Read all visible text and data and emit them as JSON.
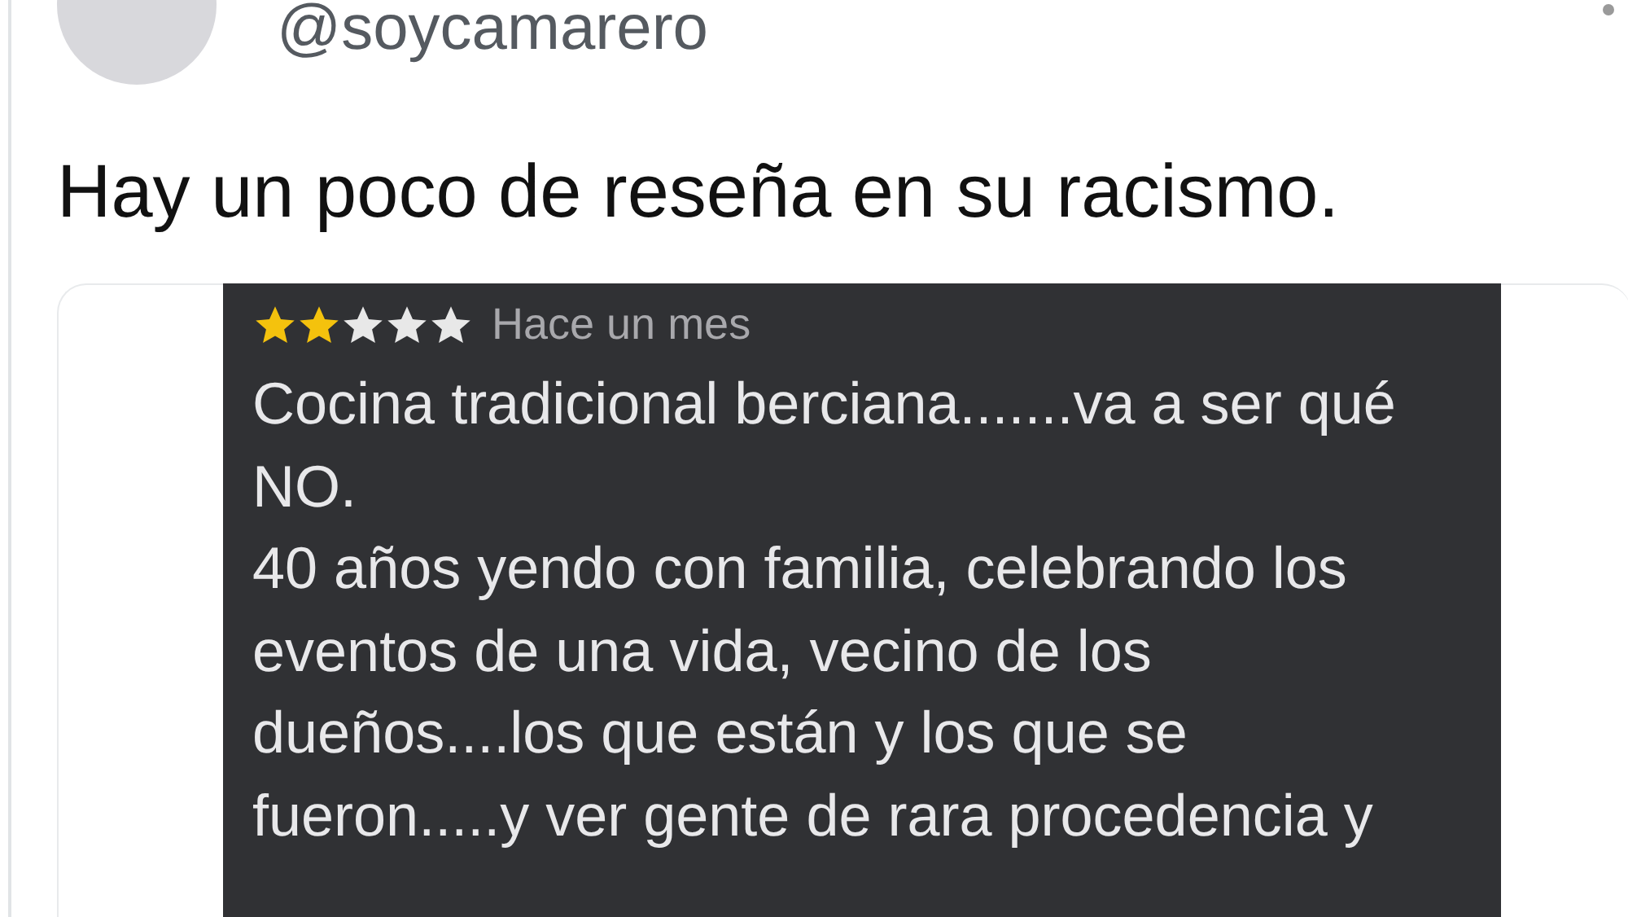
{
  "tweet": {
    "handle": "@soycamarero",
    "text": "Hay un poco de reseña en su racismo."
  },
  "review": {
    "stars": 2,
    "time": "Hace un mes",
    "lines": [
      "Cocina tradicional berciana.......va a ser qué",
      "NO.",
      "40 años yendo con familia, celebrando los",
      "eventos de una vida, vecino de los",
      "dueños....los que están y los que se",
      "fueron.....y ver gente de rara procedencia y"
    ]
  }
}
